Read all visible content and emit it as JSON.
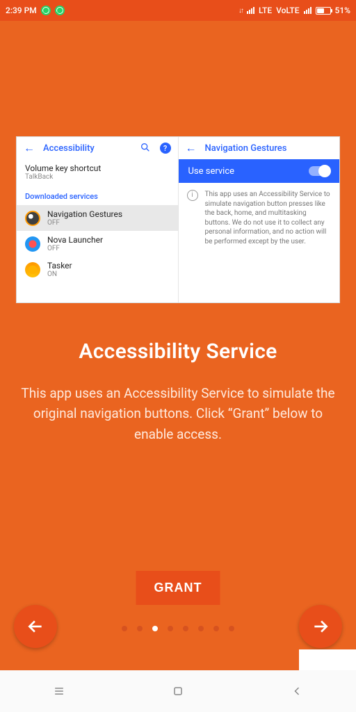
{
  "statusbar": {
    "time": "2:39 PM",
    "net1": "LTE",
    "net2": "VoLTE",
    "battery_pct": "51%"
  },
  "card": {
    "left": {
      "title": "Accessibility",
      "vks_title": "Volume key shortcut",
      "vks_sub": "TalkBack",
      "section": "Downloaded services",
      "items": [
        {
          "name": "Navigation Gestures",
          "state": "OFF"
        },
        {
          "name": "Nova Launcher",
          "state": "OFF"
        },
        {
          "name": "Tasker",
          "state": "ON"
        }
      ]
    },
    "right": {
      "title": "Navigation Gestures",
      "use_label": "Use service",
      "info": "This app uses an Accessibility Service to simulate navigation button presses like the back, home, and multitasking buttons. We do not use it to collect any personal information, and no action will be performed except by the user."
    }
  },
  "hero": {
    "title": "Accessibility Service",
    "body": "This app uses an Accessibility Service to simulate the original navigation buttons. Click “Grant” below to enable access."
  },
  "buttons": {
    "grant": "GRANT"
  },
  "pager": {
    "count": 8,
    "active_index": 2
  }
}
